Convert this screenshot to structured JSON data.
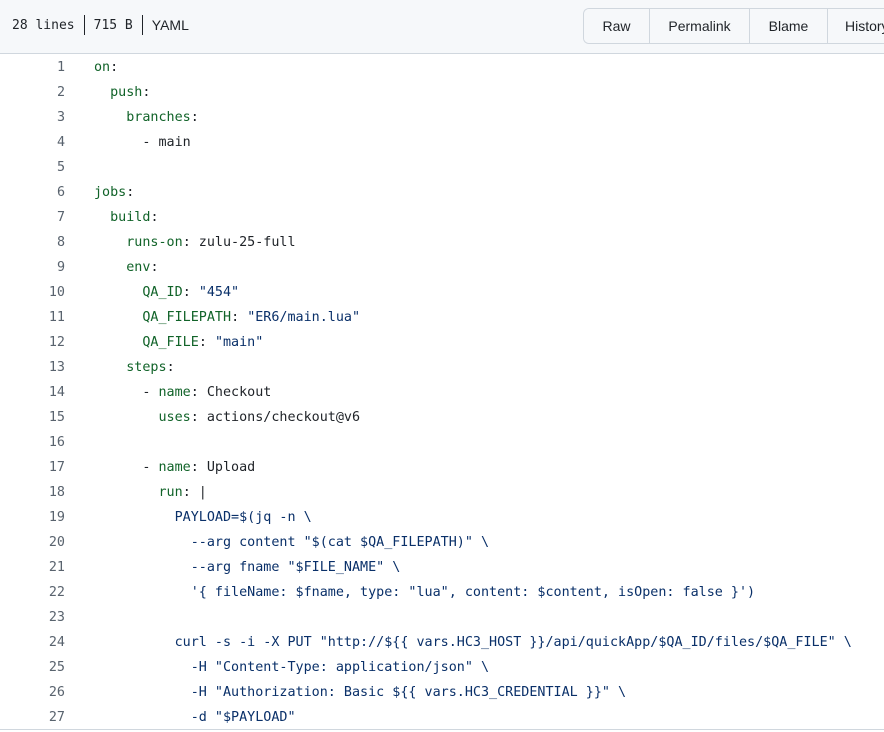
{
  "file_info": {
    "lines": "28 lines",
    "size": "715 B",
    "language": "YAML"
  },
  "toolbar": {
    "raw_label": "Raw",
    "permalink_label": "Permalink",
    "blame_label": "Blame",
    "history_label": "History"
  },
  "colors": {
    "key": "#116329",
    "string": "#0a3069",
    "line_number": "#59636e",
    "text": "#1f2328",
    "header_bg": "#f6f8fa",
    "border": "#d0d7de"
  },
  "code_lines": [
    {
      "num": "1",
      "indent": "",
      "tokens": [
        {
          "t": "on",
          "c": "k"
        },
        {
          "t": ":",
          "c": ""
        }
      ]
    },
    {
      "num": "2",
      "indent": "  ",
      "tokens": [
        {
          "t": "push",
          "c": "k"
        },
        {
          "t": ":",
          "c": ""
        }
      ]
    },
    {
      "num": "3",
      "indent": "    ",
      "tokens": [
        {
          "t": "branches",
          "c": "k"
        },
        {
          "t": ":",
          "c": ""
        }
      ]
    },
    {
      "num": "4",
      "indent": "      ",
      "tokens": [
        {
          "t": "- main",
          "c": ""
        }
      ]
    },
    {
      "num": "5",
      "indent": "",
      "tokens": []
    },
    {
      "num": "6",
      "indent": "",
      "tokens": [
        {
          "t": "jobs",
          "c": "k"
        },
        {
          "t": ":",
          "c": ""
        }
      ]
    },
    {
      "num": "7",
      "indent": "  ",
      "tokens": [
        {
          "t": "build",
          "c": "k"
        },
        {
          "t": ":",
          "c": ""
        }
      ]
    },
    {
      "num": "8",
      "indent": "    ",
      "tokens": [
        {
          "t": "runs-on",
          "c": "k"
        },
        {
          "t": ": zulu-25-full",
          "c": ""
        }
      ]
    },
    {
      "num": "9",
      "indent": "    ",
      "tokens": [
        {
          "t": "env",
          "c": "k"
        },
        {
          "t": ":",
          "c": ""
        }
      ]
    },
    {
      "num": "10",
      "indent": "      ",
      "tokens": [
        {
          "t": "QA_ID",
          "c": "k"
        },
        {
          "t": ": ",
          "c": ""
        },
        {
          "t": "\"454\"",
          "c": "s"
        }
      ]
    },
    {
      "num": "11",
      "indent": "      ",
      "tokens": [
        {
          "t": "QA_FILEPATH",
          "c": "k"
        },
        {
          "t": ": ",
          "c": ""
        },
        {
          "t": "\"ER6/main.lua\"",
          "c": "s"
        }
      ]
    },
    {
      "num": "12",
      "indent": "      ",
      "tokens": [
        {
          "t": "QA_FILE",
          "c": "k"
        },
        {
          "t": ": ",
          "c": ""
        },
        {
          "t": "\"main\"",
          "c": "s"
        }
      ]
    },
    {
      "num": "13",
      "indent": "    ",
      "tokens": [
        {
          "t": "steps",
          "c": "k"
        },
        {
          "t": ":",
          "c": ""
        }
      ]
    },
    {
      "num": "14",
      "indent": "      ",
      "tokens": [
        {
          "t": "- ",
          "c": ""
        },
        {
          "t": "name",
          "c": "k"
        },
        {
          "t": ": Checkout",
          "c": ""
        }
      ]
    },
    {
      "num": "15",
      "indent": "        ",
      "tokens": [
        {
          "t": "uses",
          "c": "k"
        },
        {
          "t": ": actions/checkout@v6",
          "c": ""
        }
      ]
    },
    {
      "num": "16",
      "indent": "",
      "tokens": []
    },
    {
      "num": "17",
      "indent": "      ",
      "tokens": [
        {
          "t": "- ",
          "c": ""
        },
        {
          "t": "name",
          "c": "k"
        },
        {
          "t": ": Upload",
          "c": ""
        }
      ]
    },
    {
      "num": "18",
      "indent": "        ",
      "tokens": [
        {
          "t": "run",
          "c": "k"
        },
        {
          "t": ": |",
          "c": ""
        }
      ]
    },
    {
      "num": "19",
      "indent": "          ",
      "tokens": [
        {
          "t": "PAYLOAD=$(jq -n \\",
          "c": "s"
        }
      ]
    },
    {
      "num": "20",
      "indent": "            ",
      "tokens": [
        {
          "t": "--arg content \"$(cat $QA_FILEPATH)\" \\",
          "c": "s"
        }
      ]
    },
    {
      "num": "21",
      "indent": "            ",
      "tokens": [
        {
          "t": "--arg fname \"$FILE_NAME\" \\",
          "c": "s"
        }
      ]
    },
    {
      "num": "22",
      "indent": "            ",
      "tokens": [
        {
          "t": "'{ fileName: $fname, type: \"lua\", content: $content, isOpen: false }')",
          "c": "s"
        }
      ]
    },
    {
      "num": "23",
      "indent": "",
      "tokens": []
    },
    {
      "num": "24",
      "indent": "          ",
      "tokens": [
        {
          "t": "curl -s -i -X PUT \"http://${{ vars.HC3_HOST }}/api/quickApp/$QA_ID/files/$QA_FILE\" \\",
          "c": "s"
        }
      ]
    },
    {
      "num": "25",
      "indent": "            ",
      "tokens": [
        {
          "t": "-H \"Content-Type: application/json\" \\",
          "c": "s"
        }
      ]
    },
    {
      "num": "26",
      "indent": "            ",
      "tokens": [
        {
          "t": "-H \"Authorization: Basic ${{ vars.HC3_CREDENTIAL }}\" \\",
          "c": "s"
        }
      ]
    },
    {
      "num": "27",
      "indent": "            ",
      "tokens": [
        {
          "t": "-d \"$PAYLOAD\"",
          "c": "s"
        }
      ]
    }
  ]
}
